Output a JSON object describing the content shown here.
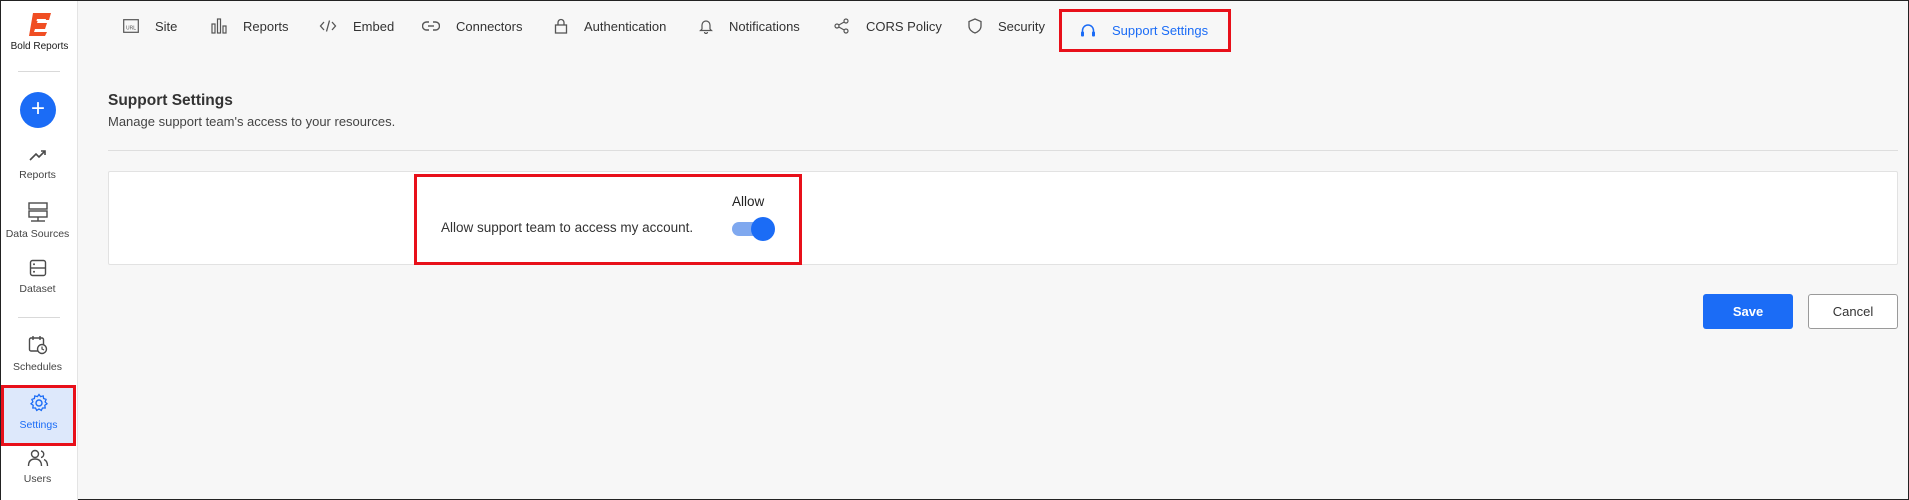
{
  "brand": {
    "name": "Bold Reports",
    "accent": "#f04e23"
  },
  "sidebar": {
    "add_label": "+",
    "items": [
      {
        "label": "Reports",
        "icon": "trend-up-icon"
      },
      {
        "label": "Data Sources",
        "icon": "data-sources-icon"
      },
      {
        "label": "Dataset",
        "icon": "dataset-icon"
      },
      {
        "label": "Schedules",
        "icon": "calendar-clock-icon"
      },
      {
        "label": "Settings",
        "icon": "gear-icon",
        "active": true
      },
      {
        "label": "Users",
        "icon": "users-icon"
      }
    ]
  },
  "tabs": [
    {
      "label": "Site",
      "icon": "url-icon"
    },
    {
      "label": "Reports",
      "icon": "bar-chart-icon"
    },
    {
      "label": "Embed",
      "icon": "code-icon"
    },
    {
      "label": "Connectors",
      "icon": "link-icon"
    },
    {
      "label": "Authentication",
      "icon": "lock-icon"
    },
    {
      "label": "Notifications",
      "icon": "bell-icon"
    },
    {
      "label": "CORS Policy",
      "icon": "share-icon"
    },
    {
      "label": "Security",
      "icon": "shield-icon"
    },
    {
      "label": "Support Settings",
      "icon": "headset-icon",
      "active": true
    }
  ],
  "page": {
    "title": "Support Settings",
    "subtitle": "Manage support team's access to your resources."
  },
  "setting": {
    "column_label": "Allow",
    "description": "Allow support team to access my account.",
    "enabled": true
  },
  "actions": {
    "save": "Save",
    "cancel": "Cancel"
  },
  "colors": {
    "primary": "#1b6cf6",
    "highlight": "#e8101a"
  }
}
